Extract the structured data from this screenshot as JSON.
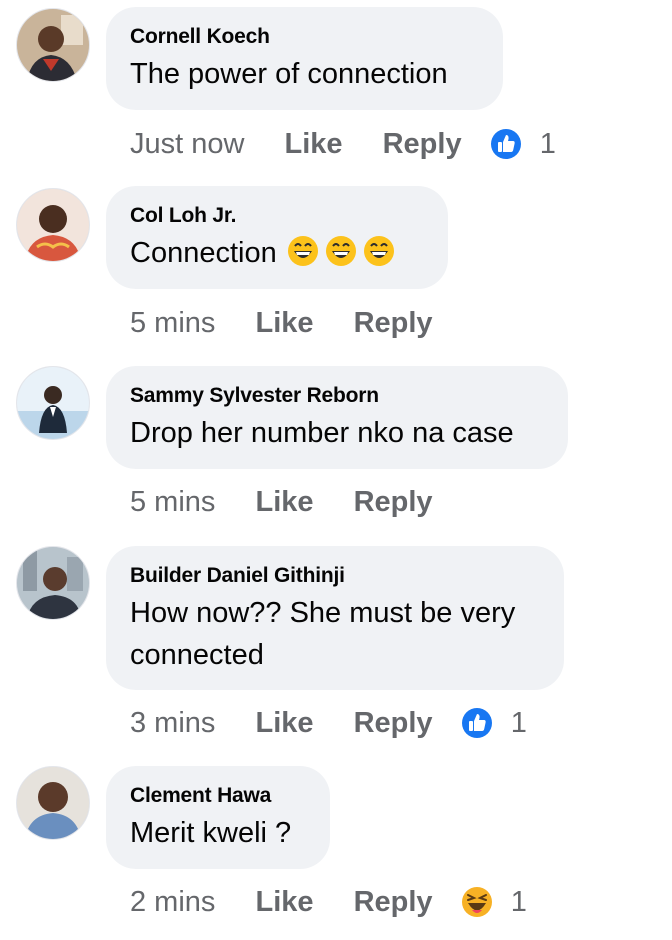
{
  "comments": [
    {
      "author": "Cornell Koech",
      "text": "The power of connection",
      "time": "Just now",
      "like_label": "Like",
      "reply_label": "Reply",
      "reaction": "like-icon",
      "reaction_count": "1",
      "avatar_color": "#8a5a3c"
    },
    {
      "author": "Col Loh Jr.",
      "text": "Connection",
      "emojis": [
        "grinning-face-icon",
        "grinning-face-icon",
        "grinning-face-icon"
      ],
      "time": "5 mins",
      "like_label": "Like",
      "reply_label": "Reply",
      "avatar_color": "#c06a52"
    },
    {
      "author": "Sammy Sylvester Reborn",
      "text": "Drop her number nko na case",
      "time": "5 mins",
      "like_label": "Like",
      "reply_label": "Reply",
      "avatar_color": "#8fb8d8"
    },
    {
      "author": "Builder Daniel Githinji",
      "text": "How now?? She must be very connected",
      "time": "3 mins",
      "like_label": "Like",
      "reply_label": "Reply",
      "reaction": "like-icon",
      "reaction_count": "1",
      "avatar_color": "#8a9aa8"
    },
    {
      "author": "Clement Hawa",
      "text": "Merit kweli ?",
      "time": "2 mins",
      "like_label": "Like",
      "reply_label": "Reply",
      "reaction": "haha-icon",
      "reaction_count": "1",
      "avatar_color": "#6b4a38"
    }
  ],
  "colors": {
    "bubble": "#f0f2f5",
    "muted_text": "#65676b",
    "like_blue": "#1877f2",
    "haha_yellow": "#f7b125"
  }
}
